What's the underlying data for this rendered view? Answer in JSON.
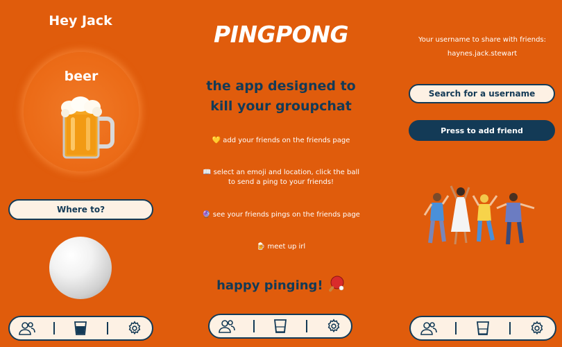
{
  "left": {
    "greeting": "Hey Jack",
    "emoji_name": "beer",
    "where_placeholder": "Where to?"
  },
  "middle": {
    "brand": "PINGPONG",
    "tagline_line1": "the app designed to",
    "tagline_line2": "kill your groupchat",
    "steps": [
      {
        "icon": "yellow-heart-icon",
        "text": "add your friends on the friends page"
      },
      {
        "icon": "map-icon",
        "text_line1": "select an emoji and location, click the ball",
        "text_line2": "to send a ping to your friends!"
      },
      {
        "icon": "purple-orb-icon",
        "text": "see your friends pings on the friends page"
      },
      {
        "icon": "beer-icon",
        "text": "meet up irl"
      }
    ],
    "closing": "happy pinging!"
  },
  "right": {
    "share_label": "Your username to share with friends:",
    "username": "haynes.jack.stewart",
    "search_placeholder": "Search for a username",
    "add_button": "Press to add friend"
  },
  "nav": {
    "items": [
      "friends-icon",
      "drink-cup-icon",
      "gear-icon"
    ]
  },
  "colors": {
    "background": "#e05c0c",
    "navy": "#133a56",
    "cream": "#fdf1e4"
  }
}
